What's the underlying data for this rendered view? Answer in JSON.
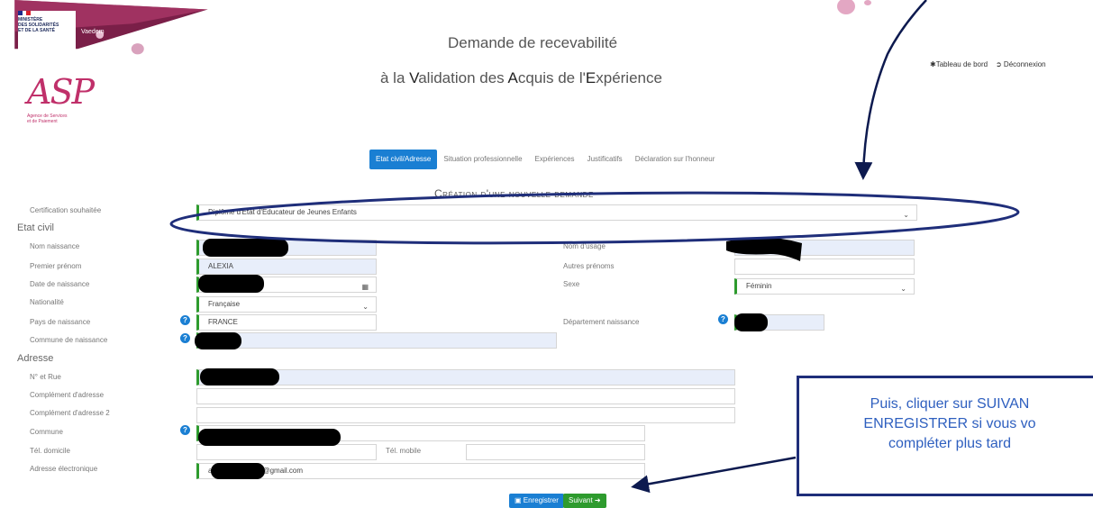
{
  "header": {
    "ministere_lines": [
      "MINISTÈRE",
      "DES SOLIDARITÉS",
      "ET DE LA SANTÉ"
    ],
    "vaedem": "Vaedem",
    "asp_logo": "ASP",
    "asp_sub": [
      "Agence de Services",
      "et de Paiement"
    ],
    "title_line1": "Demande de recevabilité",
    "title_line2_parts": [
      "à la ",
      "V",
      "alidation des ",
      "A",
      "cquis de l'",
      "E",
      "xpérience"
    ],
    "tableau_de_bord": "Tableau de bord",
    "deconnexion": "Déconnexion"
  },
  "tabs": [
    "Etat civil/Adresse",
    "Situation professionnelle",
    "Expériences",
    "Justificatifs",
    "Déclaration sur l'honneur"
  ],
  "active_tab": 0,
  "section_title": "Création d'une nouvelle demande",
  "form": {
    "certification_label": "Certification souhaitée",
    "certification_value": "Diplôme d'Etat d'Educateur de Jeunes Enfants",
    "etat_civil_heading": "Etat civil",
    "nom_naissance_label": "Nom naissance",
    "premier_prenom_label": "Premier prénom",
    "premier_prenom_value": "ALEXIA",
    "date_naissance_label": "Date de naissance",
    "nationalite_label": "Nationalité",
    "nationalite_value": "Française",
    "pays_naissance_label": "Pays de naissance",
    "pays_naissance_value": "FRANCE",
    "commune_naissance_label": "Commune de naissance",
    "nom_usage_label": "Nom d'usage",
    "autres_prenoms_label": "Autres prénoms",
    "sexe_label": "Sexe",
    "sexe_value": "Féminin",
    "departement_label": "Département naissance",
    "adresse_heading": "Adresse",
    "rue_label": "N° et Rue",
    "complement_label": "Complément d'adresse",
    "complement2_label": "Complément d'adresse 2",
    "commune_label": "Commune",
    "tel_domicile_label": "Tél. domicile",
    "tel_mobile_label": "Tél. mobile",
    "email_label": "Adresse électronique",
    "email_prefix": "alexi",
    "email_suffix": "@gmail.com"
  },
  "buttons": {
    "enregistrer": "Enregistrer",
    "suivant": "Suivant"
  },
  "callout_lines": [
    "Puis, cliquer sur SUIVAN",
    "ENREGISTRER si vous vo",
    "compléter plus tard"
  ],
  "colors": {
    "accent": "#1a7fd3",
    "success": "#2e9b2e",
    "annotation": "#1f2e7a",
    "brand": "#c0306a"
  }
}
